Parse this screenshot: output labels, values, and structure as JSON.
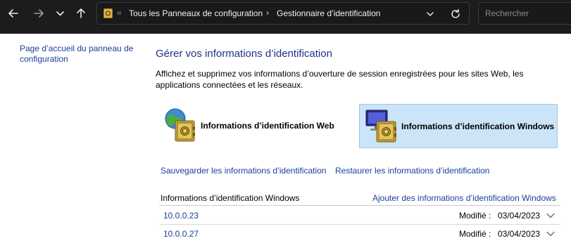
{
  "nav": {
    "back_icon": "arrow-left-icon",
    "forward_icon": "arrow-right-icon",
    "recent_icon": "chevron-down-icon",
    "up_icon": "arrow-up-icon"
  },
  "address": {
    "overflow": "«",
    "crumb1": "Tous les Panneaux de configuration",
    "separator": "›",
    "crumb2": "Gestionnaire d’identification",
    "refresh_icon": "refresh-icon"
  },
  "search": {
    "placeholder": "Rechercher"
  },
  "sidebar": {
    "home_link": "Page d’accueil du panneau de configuration"
  },
  "main": {
    "title": "Gérer vos informations d’identification",
    "description": "Affichez et supprimez vos informations d’ouverture de session enregistrées pour les sites Web, les applications connectées et les réseaux.",
    "tiles": [
      {
        "label": "Informations d’identification Web",
        "icon": "web-credentials-vault-icon",
        "selected": false
      },
      {
        "label": "Informations d’identification Windows",
        "icon": "windows-credentials-vault-icon",
        "selected": true
      }
    ],
    "backup_link": "Sauvegarder les informations d’identification",
    "restore_link": "Restaurer les informations d’identification",
    "section": {
      "heading": "Informations d’identification Windows",
      "add_link": "Ajouter des informations d’identification Windows",
      "rows": [
        {
          "name": "10.0.0.23",
          "modified_label": "Modifié :",
          "modified_date": "03/04/2023"
        },
        {
          "name": "10.0.0.27",
          "modified_label": "Modifié :",
          "modified_date": "03/04/2023"
        }
      ]
    }
  },
  "colors": {
    "topbar": "#1c1c1c",
    "link": "#1a3f9b",
    "title": "#1e3287",
    "selected_tile": "#cce4f7"
  }
}
